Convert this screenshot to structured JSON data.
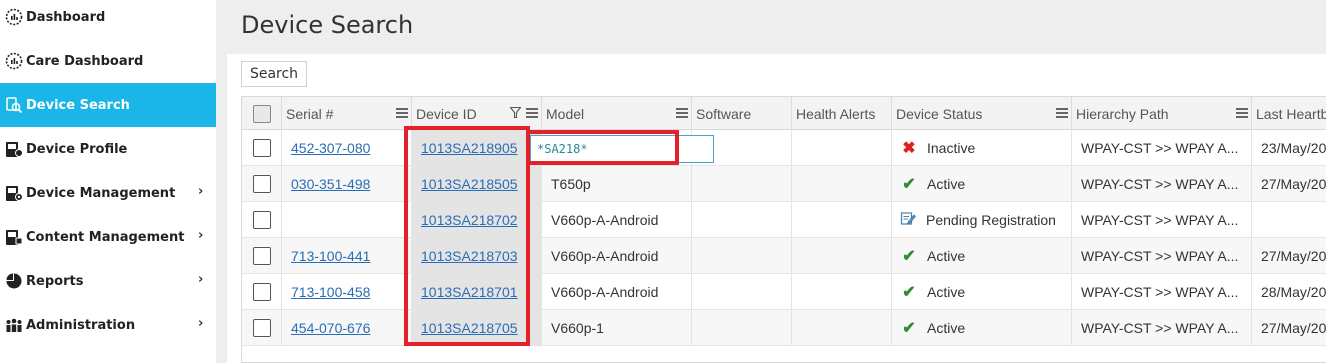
{
  "sidebar": {
    "items": [
      {
        "label": "Dashboard",
        "icon": "dashboard-gauge-icon",
        "has_submenu": false,
        "active": false
      },
      {
        "label": "Care Dashboard",
        "icon": "care-dashboard-gauge-icon",
        "has_submenu": false,
        "active": false
      },
      {
        "label": "Device Search",
        "icon": "device-search-icon",
        "has_submenu": false,
        "active": true
      },
      {
        "label": "Device Profile",
        "icon": "device-profile-icon",
        "has_submenu": false,
        "active": false
      },
      {
        "label": "Device Management",
        "icon": "device-management-icon",
        "has_submenu": true,
        "active": false
      },
      {
        "label": "Content Management",
        "icon": "content-management-icon",
        "has_submenu": true,
        "active": false
      },
      {
        "label": "Reports",
        "icon": "reports-pie-icon",
        "has_submenu": true,
        "active": false
      },
      {
        "label": "Administration",
        "icon": "administration-users-icon",
        "has_submenu": true,
        "active": false
      }
    ],
    "chevron": "›"
  },
  "page": {
    "title": "Device Search"
  },
  "toolbar": {
    "search_label": "Search"
  },
  "table": {
    "columns": [
      "Serial #",
      "Device ID",
      "Model",
      "Software",
      "Health Alerts",
      "Device Status",
      "Hierarchy Path",
      "Last Heartb"
    ],
    "filter": {
      "column": "Device ID",
      "value": "*SA218*"
    },
    "rows": [
      {
        "serial": "452-307-080",
        "device_id": "1013SA218905",
        "model": "",
        "software": "",
        "health": "",
        "status": "Inactive",
        "status_icon": "x-icon",
        "hierarchy": "WPAY-CST >> WPAY A...",
        "heartbeat": "23/May/20"
      },
      {
        "serial": "030-351-498",
        "device_id": "1013SA218505",
        "model": "T650p",
        "software": "",
        "health": "",
        "status": "Active",
        "status_icon": "check-icon",
        "hierarchy": "WPAY-CST >> WPAY A...",
        "heartbeat": "27/May/20"
      },
      {
        "serial": "",
        "device_id": "1013SA218702",
        "model": "V660p-A-Android",
        "software": "",
        "health": "",
        "status": "Pending Registration",
        "status_icon": "pending-registration-icon",
        "hierarchy": "WPAY-CST >> WPAY A...",
        "heartbeat": ""
      },
      {
        "serial": "713-100-441",
        "device_id": "1013SA218703",
        "model": "V660p-A-Android",
        "software": "",
        "health": "",
        "status": "Active",
        "status_icon": "check-icon",
        "hierarchy": "WPAY-CST >> WPAY A...",
        "heartbeat": "27/May/20"
      },
      {
        "serial": "713-100-458",
        "device_id": "1013SA218701",
        "model": "V660p-A-Android",
        "software": "",
        "health": "",
        "status": "Active",
        "status_icon": "check-icon",
        "hierarchy": "WPAY-CST >> WPAY A...",
        "heartbeat": "28/May/20"
      },
      {
        "serial": "454-070-676",
        "device_id": "1013SA218705",
        "model": "V660p-1",
        "software": "",
        "health": "",
        "status": "Active",
        "status_icon": "check-icon",
        "hierarchy": "WPAY-CST >> WPAY A...",
        "heartbeat": "27/May/20"
      }
    ]
  },
  "colors": {
    "active_nav": "#1bb6e8",
    "highlight": "#e2212a",
    "link": "#2a6db5",
    "status_inactive": "#e02020",
    "status_active": "#2e8b2e"
  }
}
